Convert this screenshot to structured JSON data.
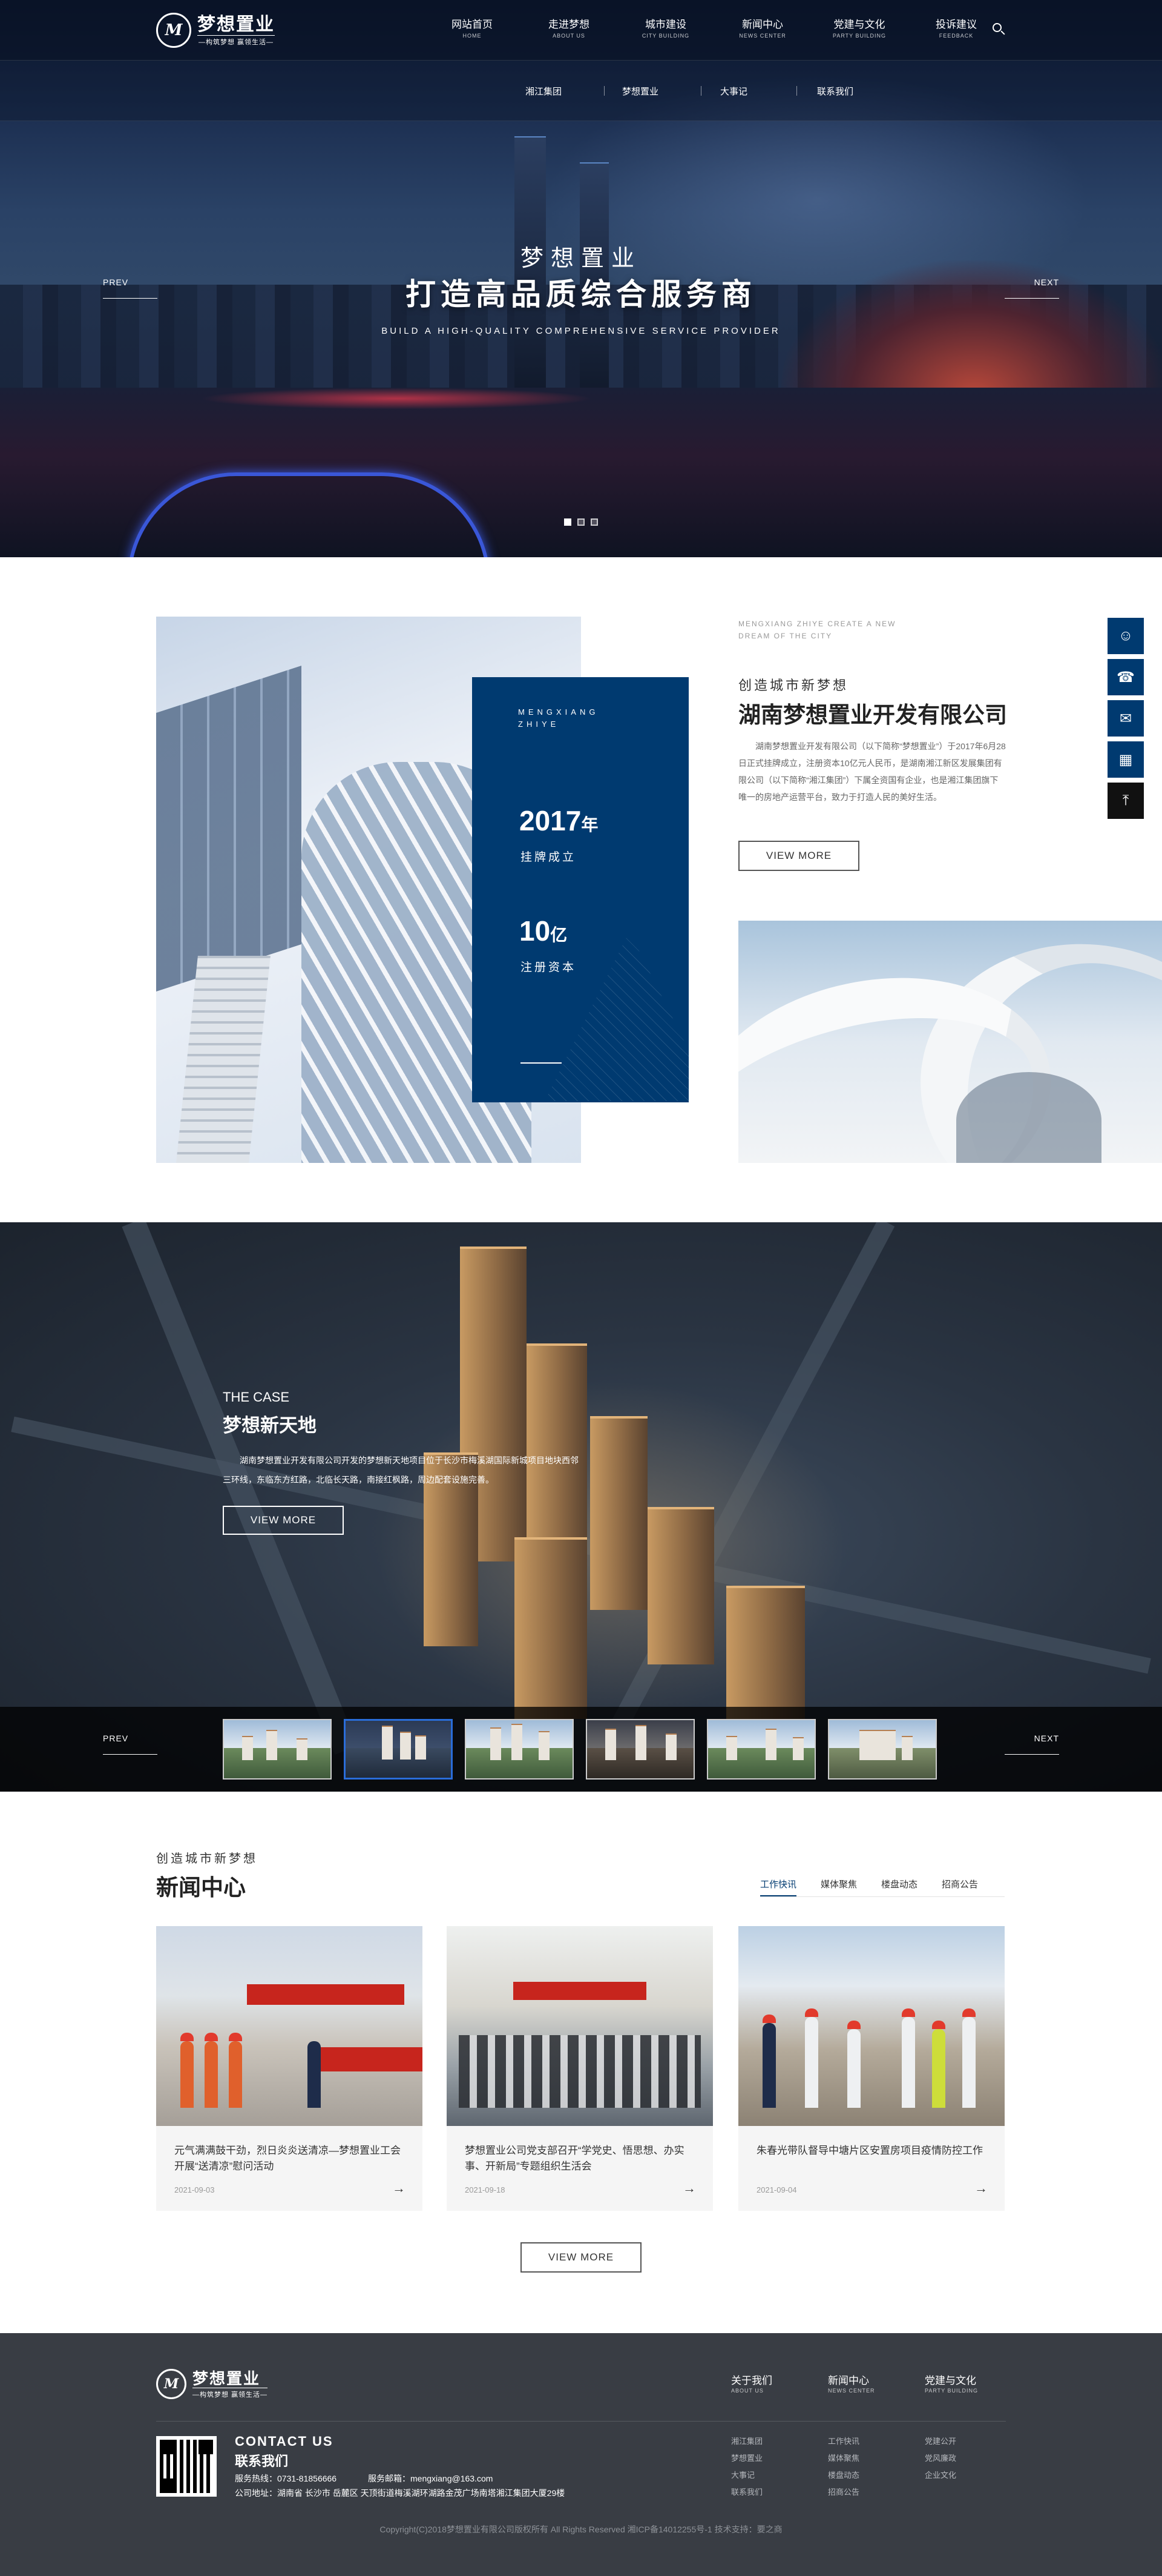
{
  "header": {
    "logo_text": "梦想置业",
    "logo_subtext": "—构筑梦想 赢领生活—",
    "nav": [
      {
        "label": "网站首页",
        "en": "HOME"
      },
      {
        "label": "走进梦想",
        "en": "ABOUT US"
      },
      {
        "label": "城市建设",
        "en": "CITY BUILDING"
      },
      {
        "label": "新闻中心",
        "en": "NEWS CENTER"
      },
      {
        "label": "党建与文化",
        "en": "PARTY BUILDING"
      },
      {
        "label": "投诉建议",
        "en": "FEEDBACK"
      }
    ],
    "subnav": [
      "湘江集团",
      "梦想置业",
      "大事记",
      "联系我们"
    ],
    "search_icon": "search-icon"
  },
  "hero": {
    "title_small": "梦想置业",
    "title_big": "打造高品质综合服务商",
    "title_en": "BUILD A HIGH-QUALITY COMPREHENSIVE SERVICE PROVIDER",
    "prev": "PREV",
    "next": "NEXT",
    "slide_count": 3,
    "active_slide": 1
  },
  "about": {
    "card_en": "MENGXIANG ZHIYE",
    "stat1_value": "2017",
    "stat1_unit": "年",
    "stat1_label": "挂牌成立",
    "stat2_value": "10",
    "stat2_unit": "亿",
    "stat2_label": "注册资本",
    "en_tagline": "MENGXIANG ZHIYE CREATE A NEW DREAM OF THE CITY",
    "slogan": "创造城市新梦想",
    "company": "湖南梦想置业开发有限公司",
    "description": "湖南梦想置业开发有限公司（以下简称“梦想置业”）于2017年6月28日正式挂牌成立，注册资本10亿元人民币，是湖南湘江新区发展集团有限公司（以下简称“湘江集团”）下属全资国有企业，也是湘江集团旗下唯一的房地产运营平台，致力于打造人民的美好生活。",
    "more": "VIEW MORE"
  },
  "float_bar": [
    "qq-icon",
    "phone-icon",
    "chat-icon",
    "qrcode-icon",
    "back-to-top-icon"
  ],
  "case": {
    "en": "THE CASE",
    "title": "梦想新天地",
    "description": "湖南梦想置业开发有限公司开发的梦想新天地项目位于长沙市梅溪湖国际新城项目地块西邻三环线，东临东方红路，北临长天路，南接红枫路，周边配套设施完善。",
    "more": "VIEW MORE",
    "prev": "PREV",
    "next": "NEXT",
    "thumb_count": 6,
    "active_thumb": 2
  },
  "news": {
    "slogan": "创造城市新梦想",
    "title": "新闻中心",
    "tabs": [
      "工作快讯",
      "媒体聚焦",
      "楼盘动态",
      "招商公告"
    ],
    "active_tab": 0,
    "items": [
      {
        "title": "元气满满鼓干劲，烈日炎炎送清凉—梦想置业工会开展“送清凉”慰问活动",
        "date": "2021-09-03"
      },
      {
        "title": "梦想置业公司党支部召开“学党史、悟思想、办实事、开新局”专题组织生活会",
        "date": "2021-09-18"
      },
      {
        "title": "朱春光带队督导中塘片区安置房项目疫情防控工作",
        "date": "2021-09-04"
      }
    ],
    "more": "VIEW MORE"
  },
  "footer": {
    "logo_text": "梦想置业",
    "logo_subtext": "—构筑梦想 赢领生活—",
    "columns": [
      {
        "title": "关于我们",
        "en": "ABOUT US",
        "links": [
          "湘江集团",
          "梦想置业",
          "大事记",
          "联系我们"
        ]
      },
      {
        "title": "新闻中心",
        "en": "NEWS CENTER",
        "links": [
          "工作快讯",
          "媒体聚焦",
          "楼盘动态",
          "招商公告"
        ]
      },
      {
        "title": "党建与文化",
        "en": "PARTY BUILDING",
        "links": [
          "党建公开",
          "党风廉政",
          "企业文化"
        ]
      }
    ],
    "contact_en": "CONTACT US",
    "contact_cn": "联系我们",
    "hotline": "服务热线：0731-81856666",
    "email": "服务邮箱：mengxiang@163.com",
    "address": "公司地址：湖南省 长沙市 岳麓区 天顶街道梅溪湖环湖路金茂广场南塔湘江集团大厦29楼",
    "copyright": "Copyright(C)2018梦想置业有限公司版权所有    All Rights Reserved  湘ICP备14012255号-1  技术支持：要之商"
  }
}
